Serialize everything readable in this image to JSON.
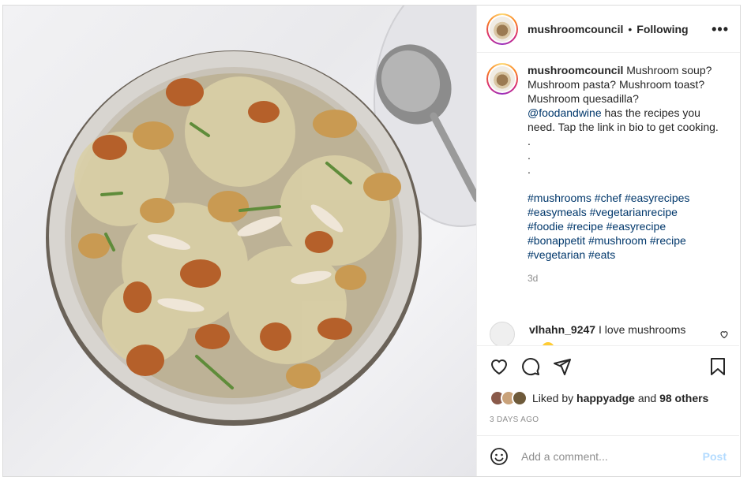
{
  "header": {
    "username": "mushroomcouncil",
    "separator": "•",
    "follow_status": "Following",
    "more_label": "•••"
  },
  "caption": {
    "username": "mushroomcouncil",
    "text_before_mention": "Mushroom soup? Mushroom pasta? Mushroom toast? Mushroom quesadilla?",
    "mention": "@foodandwine",
    "text_after_mention": "has the recipes you need. Tap the link in bio to get cooking.",
    "dots": [
      ".",
      ".",
      "."
    ],
    "hashtags": [
      "#mushrooms #chef #easyrecipes",
      "#easymeals #vegetarianrecipe",
      "#foodie #recipe #easyrecipe",
      "#bonappetit #mushroom #recipe",
      "#vegetarian #eats"
    ],
    "time_ago": "3d"
  },
  "comments": [
    {
      "username": "vlhahn_9247",
      "text": "I love mushrooms"
    }
  ],
  "actions": {
    "icons": [
      "heart-icon",
      "comment-icon",
      "share-icon",
      "bookmark-icon"
    ]
  },
  "likes": {
    "prefix": "Liked by",
    "user": "happyadge",
    "middle": "and",
    "others": "98 others"
  },
  "date": "3 DAYS AGO",
  "add_comment": {
    "placeholder": "Add a comment...",
    "post_label": "Post"
  },
  "colors": {
    "link": "#00376b",
    "post_button_disabled": "#b3dbff",
    "muted": "#8e8e8e"
  }
}
